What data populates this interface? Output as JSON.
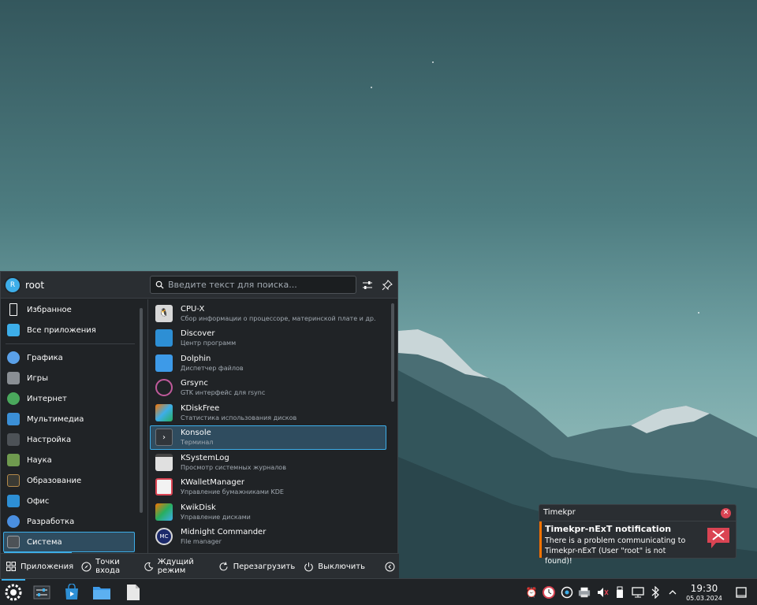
{
  "launcher": {
    "username": "root",
    "avatar_letter": "R",
    "search_placeholder": "Введите текст для поиска...",
    "categories": [
      {
        "label": "Избранное",
        "icon": "bookmark-icon"
      },
      {
        "label": "Все приложения",
        "icon": "grid-icon"
      },
      {
        "label": "Графика",
        "icon": "graphics-icon"
      },
      {
        "label": "Игры",
        "icon": "gamepad-icon"
      },
      {
        "label": "Интернет",
        "icon": "globe-icon"
      },
      {
        "label": "Мультимедиа",
        "icon": "multimedia-icon"
      },
      {
        "label": "Настройка",
        "icon": "settings-icon"
      },
      {
        "label": "Наука",
        "icon": "science-icon"
      },
      {
        "label": "Образование",
        "icon": "education-icon"
      },
      {
        "label": "Офис",
        "icon": "office-icon"
      },
      {
        "label": "Разработка",
        "icon": "development-icon"
      },
      {
        "label": "Система",
        "icon": "system-icon"
      }
    ],
    "active_category": "Система",
    "apps": [
      {
        "name": "CPU-X",
        "desc": "Сбор информации о процессоре, материнской плате и др.",
        "icon": "cpu-x-icon",
        "selected": false
      },
      {
        "name": "Discover",
        "desc": "Центр программ",
        "icon": "discover-icon",
        "selected": false
      },
      {
        "name": "Dolphin",
        "desc": "Диспетчер файлов",
        "icon": "dolphin-icon",
        "selected": false
      },
      {
        "name": "Grsync",
        "desc": "GTK интерфейс для rsync",
        "icon": "grsync-icon",
        "selected": false
      },
      {
        "name": "KDiskFree",
        "desc": "Статистика использования дисков",
        "icon": "kdiskfree-icon",
        "selected": false
      },
      {
        "name": "Konsole",
        "desc": "Терминал",
        "icon": "konsole-icon",
        "selected": true
      },
      {
        "name": "KSystemLog",
        "desc": "Просмотр системных журналов",
        "icon": "ksystemlog-icon",
        "selected": false
      },
      {
        "name": "KWalletManager",
        "desc": "Управление бумажниками KDE",
        "icon": "kwallet-icon",
        "selected": false
      },
      {
        "name": "KwikDisk",
        "desc": "Управление дисками",
        "icon": "kwikdisk-icon",
        "selected": false
      },
      {
        "name": "Midnight Commander",
        "desc": "File manager",
        "icon": "mc-icon",
        "selected": false
      }
    ],
    "footer": {
      "applications": "Приложения",
      "places": "Точки входа",
      "sleep": "Ждущий режим",
      "restart": "Перезагрузить",
      "shutdown": "Выключить"
    }
  },
  "notification": {
    "app": "Timekpr",
    "title": "Timekpr-nExT notification",
    "body": "There is a problem communicating to Timekpr-nExT (User \"root\" is not found)!"
  },
  "taskbar": {
    "time": "19:30",
    "date": "05.03.2024"
  },
  "colors": {
    "accent": "#3daee9",
    "panel": "#202326",
    "warning": "#f67400",
    "close": "#da4453"
  }
}
